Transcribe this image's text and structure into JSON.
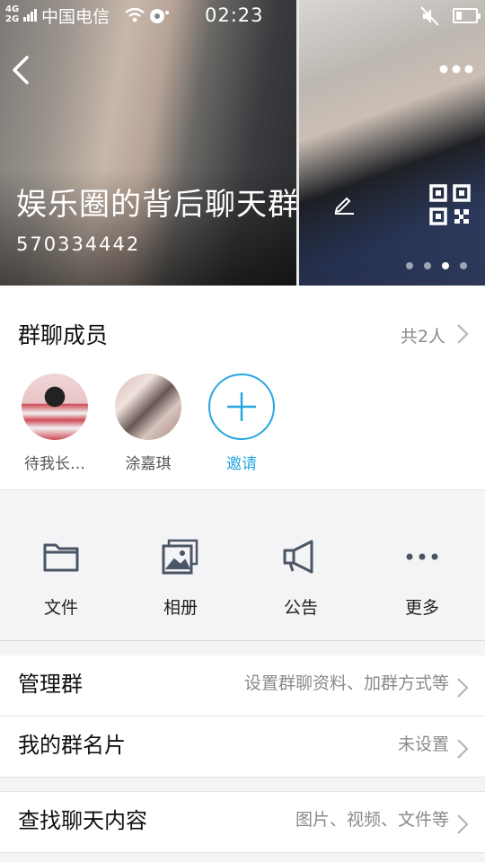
{
  "status_bar": {
    "network_top": "4G",
    "network_bottom": "2G",
    "carrier": "中国电信",
    "time": "02:23"
  },
  "header": {
    "group_name": "娱乐圈的背后聊天群",
    "group_id": "570334442",
    "page_dots": 4,
    "active_dot": 3
  },
  "members": {
    "title": "群聊成员",
    "count": "共2人",
    "list": [
      {
        "name": "待我长…"
      },
      {
        "name": "涂嘉琪"
      }
    ],
    "invite_label": "邀请"
  },
  "actions": [
    {
      "label": "文件",
      "icon": "folder-icon"
    },
    {
      "label": "相册",
      "icon": "album-icon"
    },
    {
      "label": "公告",
      "icon": "megaphone-icon"
    },
    {
      "label": "更多",
      "icon": "more-dots-icon"
    }
  ],
  "rows": {
    "manage": {
      "title": "管理群",
      "value": "设置群聊资料、加群方式等"
    },
    "my_name": {
      "title": "我的群名片",
      "value": "未设置"
    },
    "search": {
      "title": "查找聊天内容",
      "value": "图片、视频、文件等"
    }
  },
  "colors": {
    "accent": "#28a6e0",
    "icon_gray": "#4a5566",
    "secondary_text": "#8a8a8a"
  }
}
